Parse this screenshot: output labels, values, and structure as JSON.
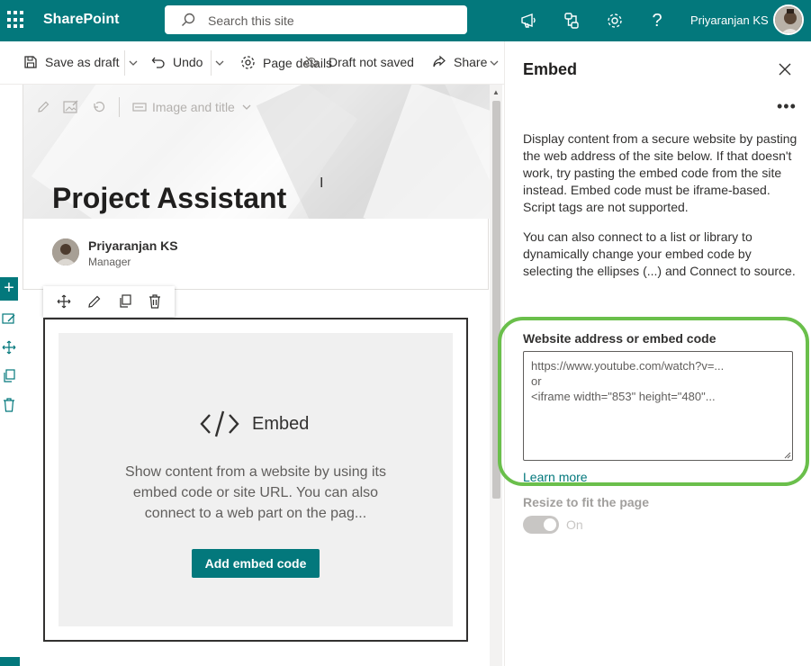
{
  "suite": {
    "brand": "SharePoint",
    "search_placeholder": "Search this site",
    "user_name": "Priyaranjan KS",
    "accent": "#03787c"
  },
  "commandbar": {
    "save_draft": "Save as draft",
    "undo": "Undo",
    "page_details": "Page details",
    "draft_status": "Draft not saved",
    "share": "Share"
  },
  "page": {
    "title": "Project Assistant",
    "layout_label": "Image and title",
    "author": {
      "name": "Priyaranjan KS",
      "role": "Manager"
    }
  },
  "webpart": {
    "name": "Embed",
    "description": "Show content from a website by using its embed code or site URL. You can also connect to a web part on the pag...",
    "add_button": "Add embed code"
  },
  "pane": {
    "title": "Embed",
    "description_1": "Display content from a secure website by pasting the web address of the site below. If that doesn't work, try pasting the embed code from the site instead. Embed code must be iframe-based. Script tags are not supported.",
    "description_2": "You can also connect to a list or library to dynamically change your embed code by selecting the ellipses (...) and Connect to source.",
    "field_label": "Website address or embed code",
    "field_placeholder": "https://www.youtube.com/watch?v=...\nor\n<iframe width=\"853\" height=\"480\"...",
    "learn_more": "Learn more",
    "resize_label": "Resize to fit the page",
    "toggle_state": "On",
    "highlight_color": "#6abf4b"
  },
  "icons": [
    "waffle-icon",
    "search-icon",
    "megaphone-icon",
    "share-network-icon",
    "settings-icon",
    "help-icon",
    "save-icon",
    "undo-icon",
    "gear-icon",
    "share-icon",
    "close-icon",
    "more-icon",
    "embed-code-icon",
    "move-icon",
    "edit-icon",
    "duplicate-icon",
    "delete-icon",
    "add-icon"
  ]
}
